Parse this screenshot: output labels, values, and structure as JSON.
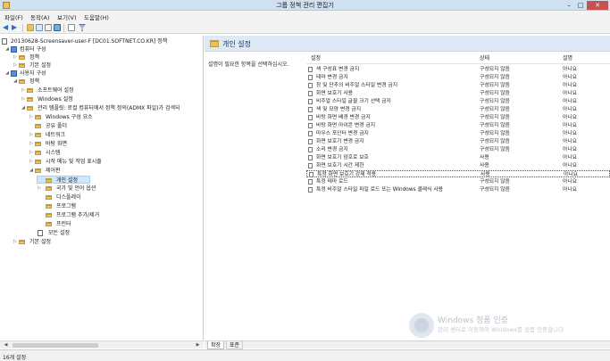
{
  "window": {
    "title": "그룹 정책 관리 편집기",
    "controls": {
      "minimize": "–",
      "maximize": "□",
      "close": "✕"
    }
  },
  "menu": [
    "파일(F)",
    "동작(A)",
    "보기(V)",
    "도움말(H)"
  ],
  "toolbar": {
    "icons": [
      "back-icon",
      "forward-icon",
      "folder-up-icon",
      "show-hide-tree-icon",
      "export-list-icon",
      "help-icon",
      "properties-icon",
      "filter-icon"
    ],
    "colors": {
      "accent": "#2c71c7"
    }
  },
  "tree": {
    "items": [
      {
        "label": "20130628-Screensaver-user-F [DC01.SOFTNET.CO.KR] 정책",
        "icon": "doc",
        "toggle": ""
      },
      {
        "label": "컴퓨터 구성",
        "icon": "computer",
        "toggle": "◢"
      },
      {
        "label": "정책",
        "icon": "folder",
        "toggle": "▷"
      },
      {
        "label": "기본 설정",
        "icon": "folder",
        "toggle": "▷"
      },
      {
        "label": "사용자 구성",
        "icon": "computer",
        "toggle": "◢"
      },
      {
        "label": "정책",
        "icon": "folder",
        "toggle": "◢"
      },
      {
        "label": "소프트웨어 설정",
        "icon": "folder",
        "toggle": "▷"
      },
      {
        "label": "Windows 설정",
        "icon": "folder",
        "toggle": "▷"
      },
      {
        "label": "관리 템플릿: 로컬 컴퓨터에서 정책 정의(ADMX 파일)가 검색되",
        "icon": "folder",
        "toggle": "◢"
      },
      {
        "label": "Windows 구성 요소",
        "icon": "folder",
        "toggle": "▷"
      },
      {
        "label": "공유 폴더",
        "icon": "folder",
        "toggle": ""
      },
      {
        "label": "네트워크",
        "icon": "folder",
        "toggle": "▷"
      },
      {
        "label": "바탕 화면",
        "icon": "folder",
        "toggle": "▷"
      },
      {
        "label": "시스템",
        "icon": "folder",
        "toggle": "▷"
      },
      {
        "label": "시작 메뉴 및 작업 표시줄",
        "icon": "folder",
        "toggle": "▷"
      },
      {
        "label": "제어판",
        "icon": "folder",
        "toggle": "◢"
      },
      {
        "label": "개인 설정",
        "icon": "folder",
        "toggle": ""
      },
      {
        "label": "국가 및 언어 옵션",
        "icon": "folder",
        "toggle": "▷"
      },
      {
        "label": "디스플레이",
        "icon": "folder",
        "toggle": ""
      },
      {
        "label": "프로그램",
        "icon": "folder",
        "toggle": ""
      },
      {
        "label": "프로그램 추가/제거",
        "icon": "folder",
        "toggle": ""
      },
      {
        "label": "프린터",
        "icon": "folder",
        "toggle": ""
      },
      {
        "label": "모든 설정",
        "icon": "doc",
        "toggle": ""
      },
      {
        "label": "기본 설정",
        "icon": "folder",
        "toggle": "▷"
      }
    ]
  },
  "right": {
    "header_title": "개인 설정",
    "description": "설명이 필요한 항목을 선택하십시오.",
    "columns": {
      "setting": "설정",
      "state": "상태",
      "comment": "설명"
    },
    "rows": [
      {
        "name": "색 구성표 변경 금지",
        "state": "구성되지 않음",
        "comment": "아니요"
      },
      {
        "name": "테마 변경 금지",
        "state": "구성되지 않음",
        "comment": "아니요"
      },
      {
        "name": "창 및 단추의 비주얼 스타일 변경 금지",
        "state": "구성되지 않음",
        "comment": "아니요"
      },
      {
        "name": "화면 보호기 사용",
        "state": "구성되지 않음",
        "comment": "아니요"
      },
      {
        "name": "비주얼 스타일 글꼴 크기 선택 금지",
        "state": "구성되지 않음",
        "comment": "아니요"
      },
      {
        "name": "색 및 모양 변경 금지",
        "state": "구성되지 않음",
        "comment": "아니요"
      },
      {
        "name": "바탕 화면 배경 변경 금지",
        "state": "구성되지 않음",
        "comment": "아니요"
      },
      {
        "name": "바탕 화면 아이콘 변경 금지",
        "state": "구성되지 않음",
        "comment": "아니요"
      },
      {
        "name": "마우스 포인터 변경 금지",
        "state": "구성되지 않음",
        "comment": "아니요"
      },
      {
        "name": "화면 보호기 변경 금지",
        "state": "구성되지 않음",
        "comment": "아니요"
      },
      {
        "name": "소리 변경 금지",
        "state": "구성되지 않음",
        "comment": "아니요"
      },
      {
        "name": "화면 보호기 암호로 보호",
        "state": "사용",
        "comment": "아니요"
      },
      {
        "name": "화면 보호기 시간 제한",
        "state": "사용",
        "comment": "아니요"
      },
      {
        "name": "특정 화면 보호기 강제 적용",
        "state": "사용",
        "comment": "아니요"
      },
      {
        "name": "특정 테마 로드",
        "state": "구성되지 않음",
        "comment": "아니요"
      },
      {
        "name": "특정 비주얼 스타일 파일 로드 또는 Windows 클래식 사용",
        "state": "구성되지 않음",
        "comment": "아니요"
      }
    ],
    "tabs": [
      "확장",
      "표준"
    ]
  },
  "status": "16개 설정",
  "watermark": {
    "title": "Windows 정품 인증",
    "subtitle": "관리 센터로 이동하여 Windows를 정품 인증합니다."
  },
  "scrollbar_arrows": {
    "left": "◀",
    "right": "▶"
  }
}
